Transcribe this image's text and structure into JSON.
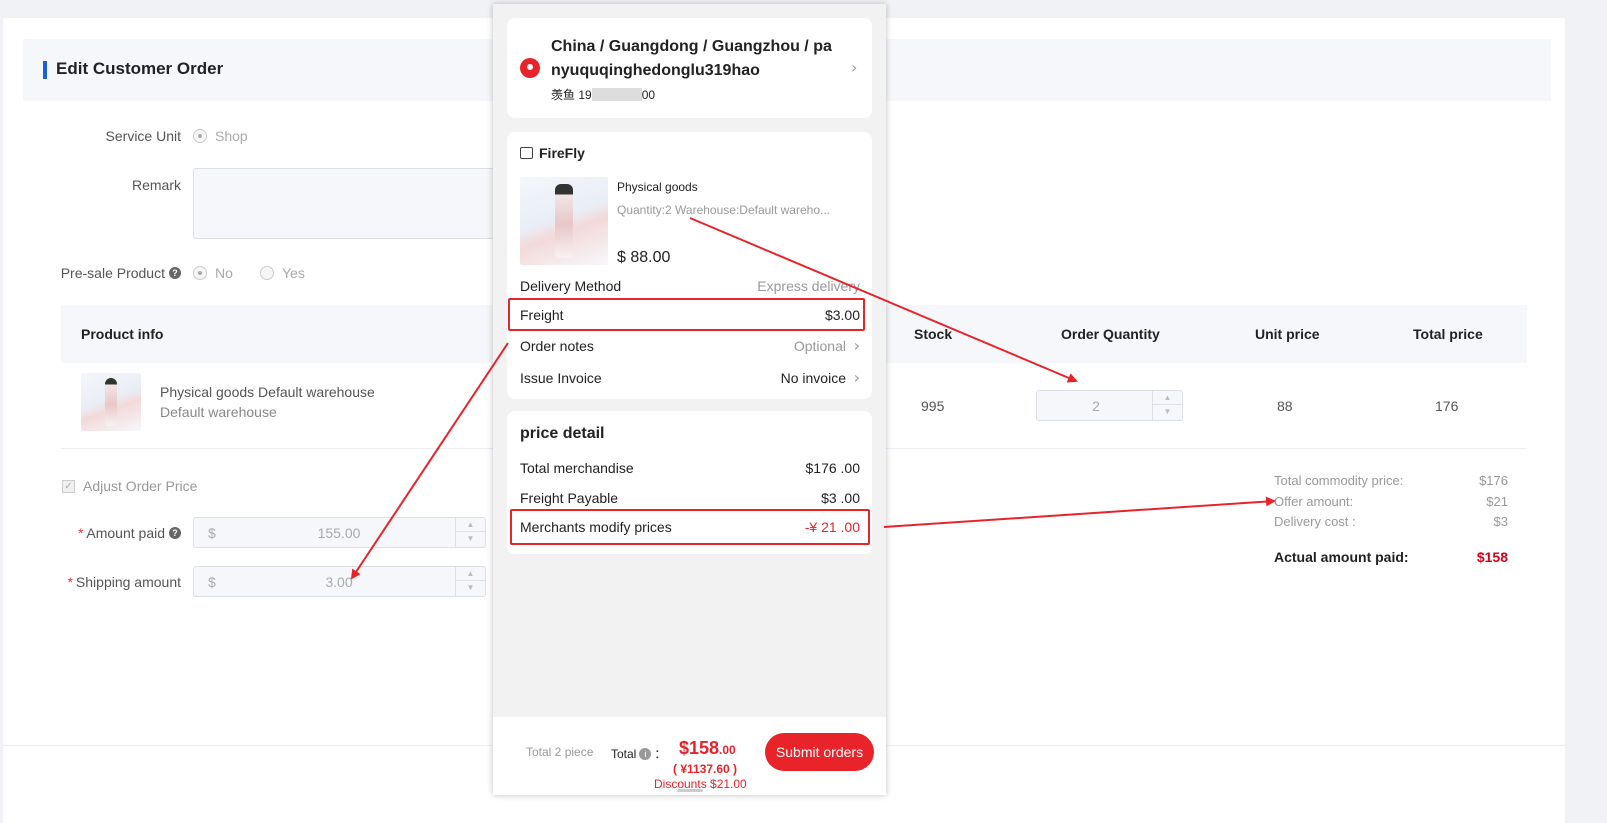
{
  "admin": {
    "title": "Edit Customer Order",
    "service_unit": {
      "label": "Service Unit",
      "option": "Shop"
    },
    "remark": {
      "label": "Remark",
      "value": ""
    },
    "presale": {
      "label": "Pre-sale Product",
      "options": [
        "No",
        "Yes"
      ],
      "selected": "No"
    },
    "table": {
      "headers": {
        "product_info": "Product info",
        "stock": "Stock",
        "order_quantity": "Order Quantity",
        "unit_price": "Unit price",
        "total_price": "Total price"
      },
      "rows": [
        {
          "name": "Physical goods Default warehouse",
          "warehouse": "Default warehouse",
          "stock": "995",
          "quantity": "2",
          "unit_price": "88",
          "total_price": "176"
        }
      ]
    },
    "adjust_price": {
      "label": "Adjust Order Price",
      "checked": true
    },
    "amount_paid": {
      "label": "Amount paid",
      "currency": "$",
      "value": "155.00"
    },
    "shipping_amount": {
      "label": "Shipping amount",
      "currency": "$",
      "value": "3.00"
    },
    "summary": {
      "total_commodity_label": "Total commodity price:",
      "total_commodity_value": "$176",
      "offer_label": "Offer amount:",
      "offer_value": "$21",
      "delivery_label": "Delivery cost :",
      "delivery_value": "$3",
      "actual_label": "Actual amount paid:",
      "actual_value": "$158"
    }
  },
  "mobile": {
    "address": {
      "line": "China / Guangdong / Guangzhou / pa nyuquqinghedonglu319hao",
      "contact_name": "羡鱼",
      "phone_prefix": "19",
      "phone_suffix": "00"
    },
    "shop": {
      "name": "FireFly",
      "product_name": "Physical goods",
      "product_meta": "Quantity:2   Warehouse:Default wareho...",
      "product_price": "$ 88.00",
      "delivery_label": "Delivery Method",
      "delivery_value": "Express delivery",
      "freight_label": "Freight",
      "freight_value": "$3.00",
      "notes_label": "Order notes",
      "notes_value": "Optional",
      "invoice_label": "Issue Invoice",
      "invoice_value": "No invoice"
    },
    "price_detail": {
      "title": "price detail",
      "merch_label": "Total merchandise",
      "merch_value": "$176 .00",
      "freight_label": "Freight Payable",
      "freight_value": "$3 .00",
      "modify_label": "Merchants modify prices",
      "modify_value": "-¥ 21 .00"
    },
    "footer": {
      "total_pieces": "Total  2  piece",
      "total_label": "Total",
      "colon": "：",
      "amount": "$158",
      "amount_cents": ".00",
      "cny": "( ¥1137.60 )",
      "discounts": "Discounts $21.00",
      "submit": "Submit orders"
    }
  },
  "colors": {
    "accent_blue": "#1a5fe0",
    "highlight_red": "#e8232a",
    "price_red": "#d0021b"
  }
}
